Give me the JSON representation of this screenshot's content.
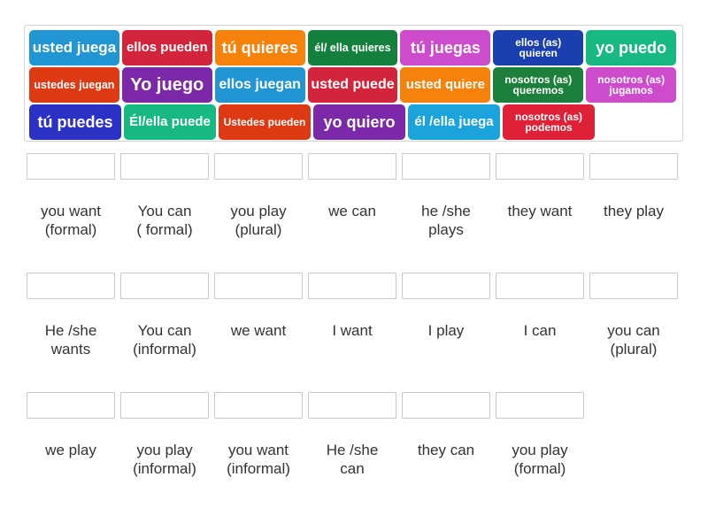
{
  "word_bank": {
    "rows": [
      [
        {
          "text": "usted juega",
          "color": "#2196d3",
          "font_size": 17,
          "width": 104
        },
        {
          "text": "ellos pueden",
          "color": "#d2253c",
          "font_size": 15,
          "width": 104
        },
        {
          "text": "tú quieres",
          "color": "#f5820b",
          "font_size": 18,
          "width": 104
        },
        {
          "text": "él/ ella quieres",
          "color": "#15803d",
          "font_size": 12.5,
          "width": 104
        },
        {
          "text": "tú juegas",
          "color": "#cc4ccc",
          "font_size": 18,
          "width": 104
        },
        {
          "text": "ellos (as) quieren",
          "color": "#1c3fb0",
          "font_size": 12,
          "width": 104
        },
        {
          "text": "yo puedo",
          "color": "#17b882",
          "font_size": 18,
          "width": 104
        }
      ],
      [
        {
          "text": "ustedes juegan",
          "color": "#dd3913",
          "font_size": 12.5,
          "width": 104
        },
        {
          "text": "Yo juego",
          "color": "#7b29a8",
          "font_size": 20,
          "width": 104
        },
        {
          "text": "ellos juegan",
          "color": "#2196d3",
          "font_size": 16,
          "width": 104
        },
        {
          "text": "usted puede",
          "color": "#d2253c",
          "font_size": 16,
          "width": 104
        },
        {
          "text": "usted quiere",
          "color": "#f5820b",
          "font_size": 15,
          "width": 104
        },
        {
          "text": "nosotros (as) queremos",
          "color": "#1d7f3c",
          "font_size": 12,
          "width": 104
        },
        {
          "text": "nosotros (as) jugamos",
          "color": "#cc4ccc",
          "font_size": 12,
          "width": 104
        }
      ],
      [
        {
          "text": "tú puedes",
          "color": "#2b31c4",
          "font_size": 18,
          "width": 104
        },
        {
          "text": "Él/ella puede",
          "color": "#17b882",
          "font_size": 15,
          "width": 104
        },
        {
          "text": "Ustedes pueden",
          "color": "#dd3913",
          "font_size": 12,
          "width": 104
        },
        {
          "text": "yo quiero",
          "color": "#7b29a8",
          "font_size": 18,
          "width": 104
        },
        {
          "text": "él /ella juega",
          "color": "#1aa3dd",
          "font_size": 15,
          "width": 104
        },
        {
          "text": "nosotros (as) podemos",
          "color": "#de2137",
          "font_size": 12,
          "width": 104
        }
      ]
    ]
  },
  "answers": {
    "rows": [
      [
        {
          "label": "you want\n(formal)"
        },
        {
          "label": "You can\n( formal)"
        },
        {
          "label": "you play\n(plural)"
        },
        {
          "label": "we can"
        },
        {
          "label": "he /she\nplays"
        },
        {
          "label": "they want"
        },
        {
          "label": "they play"
        }
      ],
      [
        {
          "label": "He /she\nwants"
        },
        {
          "label": "You can\n(informal)"
        },
        {
          "label": "we want"
        },
        {
          "label": "I want"
        },
        {
          "label": "I play"
        },
        {
          "label": "I can"
        },
        {
          "label": "you can\n(plural)"
        }
      ],
      [
        {
          "label": "we play"
        },
        {
          "label": "you play\n(informal)"
        },
        {
          "label": "you want\n(informal)"
        },
        {
          "label": "He /she\ncan"
        },
        {
          "label": "they can"
        },
        {
          "label": "you play\n(formal)"
        }
      ]
    ]
  }
}
